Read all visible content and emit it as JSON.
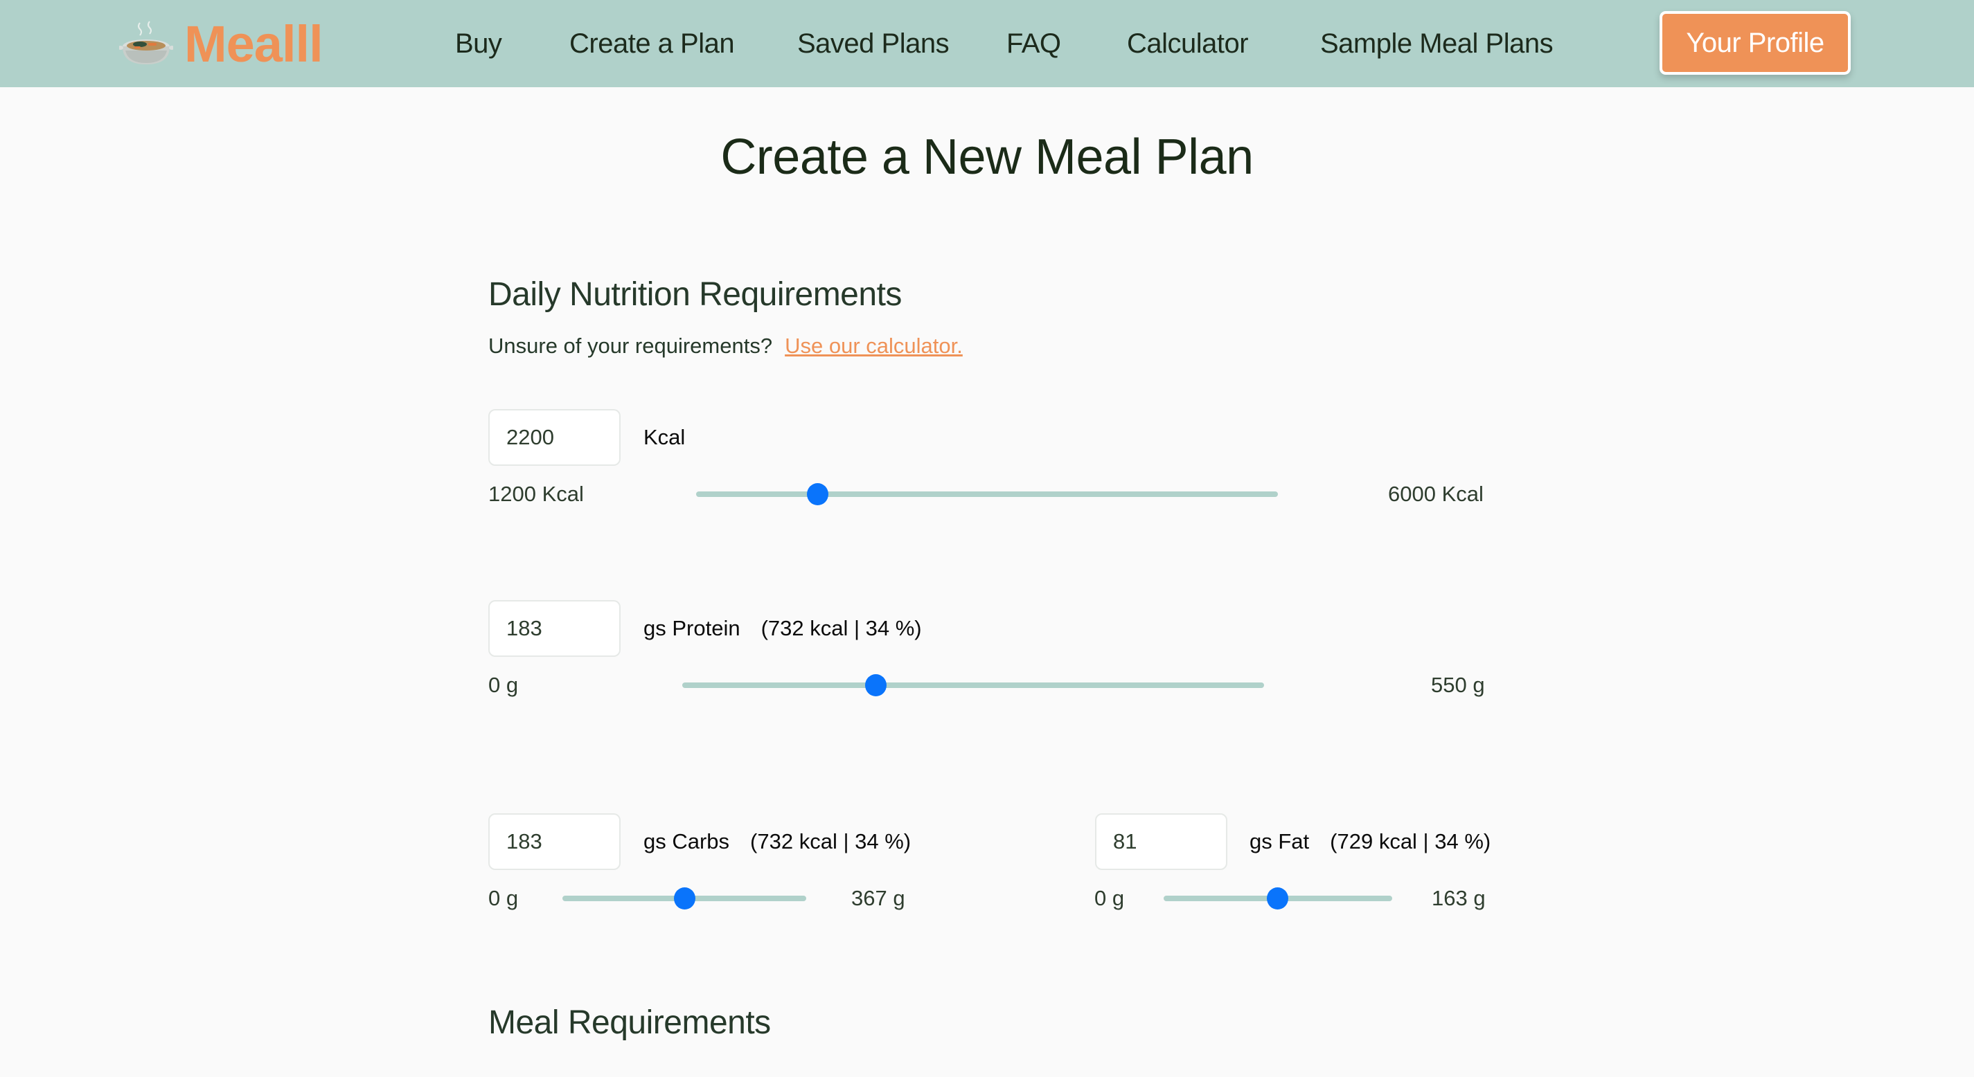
{
  "header": {
    "logo_text": "Mealll",
    "logo_icon": "soup-bowl-icon",
    "nav": [
      {
        "label": "Buy"
      },
      {
        "label": "Create a Plan"
      },
      {
        "label": "Saved Plans"
      },
      {
        "label": "FAQ"
      },
      {
        "label": "Calculator"
      },
      {
        "label": "Sample Meal Plans"
      }
    ],
    "profile_button": "Your Profile"
  },
  "colors": {
    "header_bg": "#b0d1ca",
    "accent": "#ef9257",
    "slider_thumb": "#0a74fb",
    "slider_track": "#b0d1ca",
    "page_bg": "#fafafa"
  },
  "page_title": "Create a New Meal Plan",
  "nutrition": {
    "title": "Daily Nutrition Requirements",
    "hint_text": "Unsure of your requirements?",
    "hint_link": "Use our calculator.",
    "calories": {
      "value": "2200",
      "unit_label": "Kcal",
      "min_label": "1200 Kcal",
      "max_label": "6000 Kcal",
      "min": 1200,
      "max": 6000,
      "current": 2200
    },
    "protein": {
      "value": "183",
      "unit_label": "gs Protein",
      "detail": "(732 kcal | 34 %)",
      "min_label": "0 g",
      "max_label": "550 g",
      "min": 0,
      "max": 550,
      "current": 183
    },
    "carbs": {
      "value": "183",
      "unit_label": "gs Carbs",
      "detail": "(732 kcal | 34 %)",
      "min_label": "0 g",
      "max_label": "367 g",
      "min": 0,
      "max": 367,
      "current": 183
    },
    "fat": {
      "value": "81",
      "unit_label": "gs Fat",
      "detail": "(729 kcal | 34 %)",
      "min_label": "0 g",
      "max_label": "163 g",
      "min": 0,
      "max": 163,
      "current": 81
    }
  },
  "meal": {
    "title": "Meal Requirements"
  }
}
